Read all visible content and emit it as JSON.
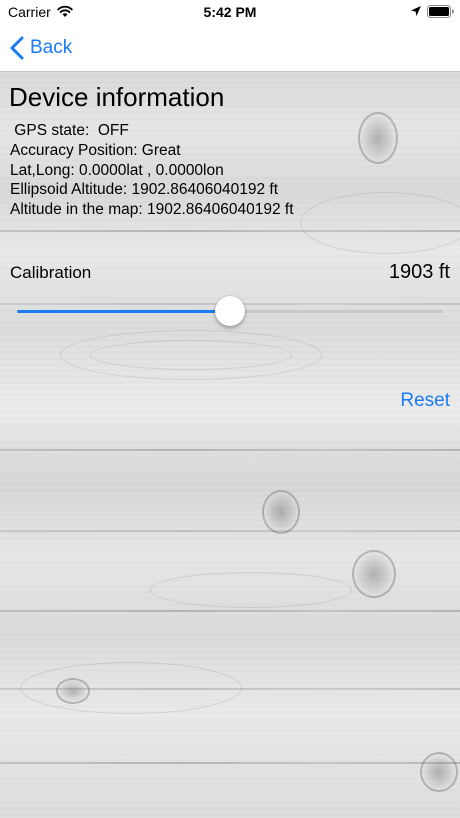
{
  "status_bar": {
    "carrier": "Carrier",
    "time": "5:42 PM",
    "wifi_icon": "wifi-icon",
    "location_icon": "location-arrow-icon",
    "battery_icon": "battery-full-icon"
  },
  "nav": {
    "back_label": "Back",
    "back_icon": "chevron-left-icon"
  },
  "device_info": {
    "title": "Device information",
    "gps_state": " GPS state:  OFF",
    "accuracy": "Accuracy Position: Great",
    "lat_long": "Lat,Long: 0.0000lat , 0.0000lon",
    "ellipsoid_altitude": "Ellipsoid Altitude: 1902.86406040192 ft",
    "map_altitude": "Altitude in the map: 1902.86406040192 ft"
  },
  "calibration": {
    "label": "Calibration",
    "value": "1903 ft",
    "slider_fraction": 0.5
  },
  "reset_label": "Reset",
  "colors": {
    "accent": "#1a7cf2",
    "track_inactive": "#c7c7cc"
  }
}
